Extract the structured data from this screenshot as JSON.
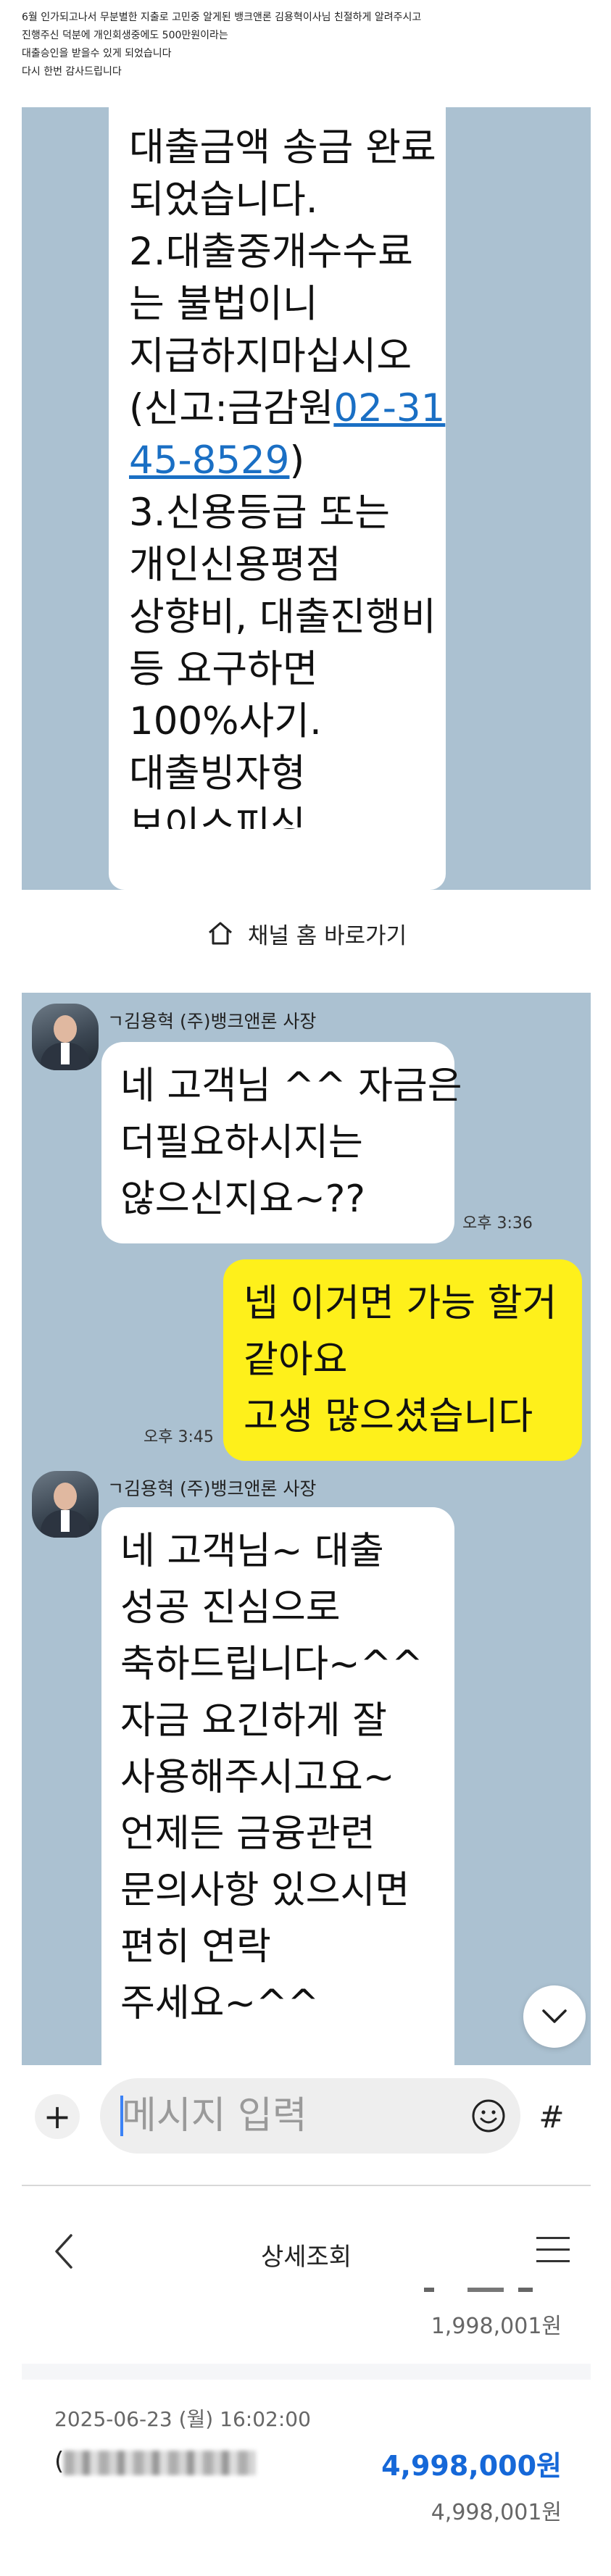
{
  "caption": {
    "lines": [
      "6월 인가되고나서 무분별한 지출로 고민중 알게된 뱅크앤론 김용혁이사님 친절하게 알려주시고",
      "진행주신 덕분에 개인회생중에도 500만원이라는",
      "대출승인을 받을수 있게 되었습니다",
      "다시 한번 감사드립니다"
    ]
  },
  "chat_top": {
    "lines": [
      "대출금액 송금 완료",
      "되었습니다.",
      "2.대출중개수수료",
      "는 불법이니",
      "지급하지마십시오",
      "(신고:금감원",
      "45-8529",
      ")",
      "3.신용등급 또는",
      "개인신용평점",
      "상향비, 대출진행비",
      "등 요구하면",
      "100%사기.",
      "대출빙자형",
      "보이스피싱"
    ],
    "phone_first": "02-31",
    "channel_home": "채널 홈 바로가기"
  },
  "chat": {
    "sender": "ㄱ김용혁 (주)뱅크앤론 사장",
    "messages": [
      {
        "lines": [
          "네 고객님 ^^ 자금은",
          "더필요하시지는",
          "않으신지요~??"
        ],
        "time": "오후 3:36"
      },
      {
        "lines": [
          "넵 이거면 가능 할거",
          "같아요",
          "고생 많으셨습니다"
        ],
        "time": "오후 3:45"
      },
      {
        "lines": [
          "네 고객님~ 대출",
          "성공 진심으로",
          "축하드립니다~^^",
          "자금 요긴하게 잘",
          "사용해주시고요~",
          "언제든 금융관련",
          "문의사항 있으시면",
          "편히 연락",
          "주세요~^^"
        ]
      }
    ],
    "scroll_icon": "chevron-down-icon"
  },
  "input": {
    "placeholder": "메시지 입력",
    "plus": "+",
    "hash": "#"
  },
  "bank": {
    "title": "상세조회",
    "balance_prev": "1,998,001원",
    "tx_date": "2025-06-23 (월) 16:02:00",
    "tx_name_prefix": "(",
    "tx_amount": "4,998,000원",
    "tx_balance": "4,998,001원",
    "amount_color": "#1668d8"
  },
  "colors": {
    "chat_bg": "#abc1d1",
    "my_bubble": "#fef01b",
    "other_bubble": "#ffffff",
    "link": "#1a6fc4"
  }
}
